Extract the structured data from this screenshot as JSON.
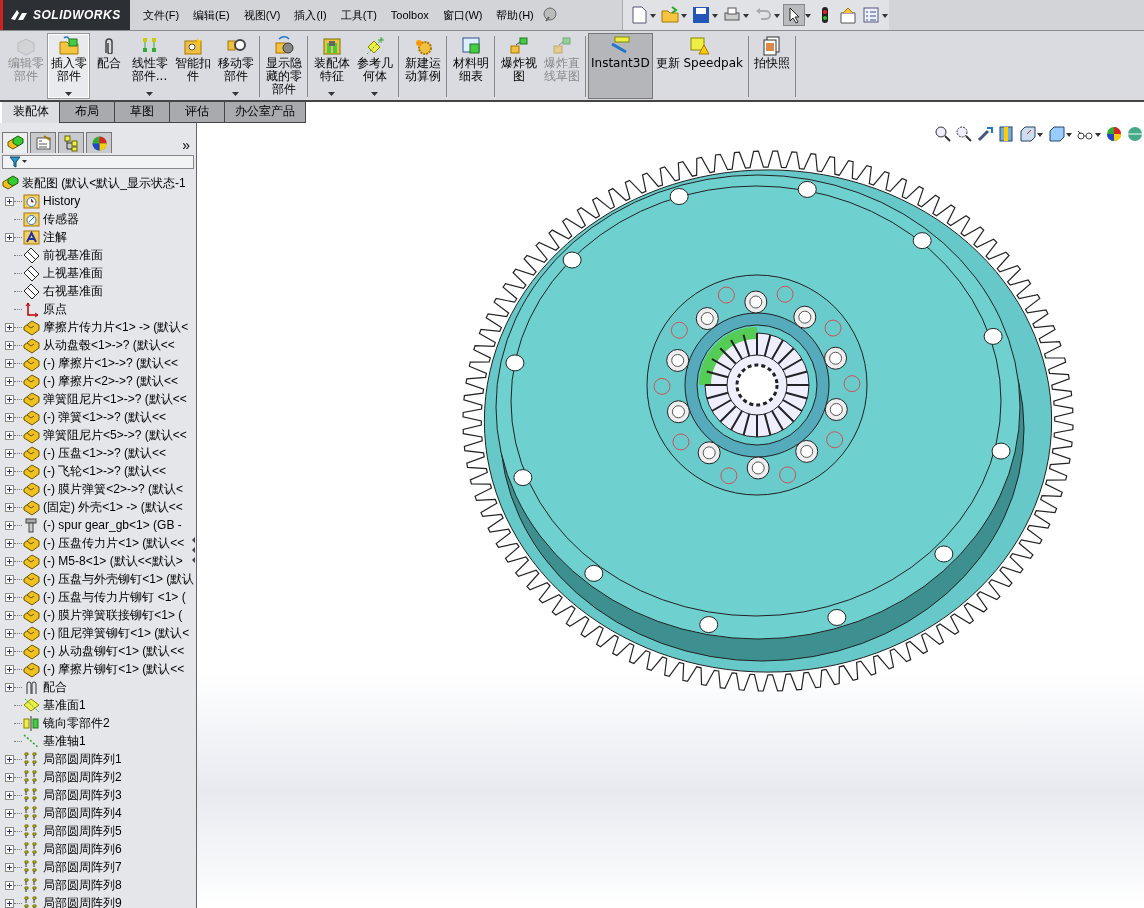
{
  "app": {
    "logo": "SOLIDWORKS"
  },
  "menu": [
    "文件(F)",
    "编辑(E)",
    "视图(V)",
    "插入(I)",
    "工具(T)",
    "Toolbox",
    "窗口(W)",
    "帮助(H)"
  ],
  "command_groups": [
    [
      {
        "label": "编辑零部件",
        "kind": "edit",
        "disabled": true,
        "selected": false,
        "dropdown": false
      },
      {
        "label": "插入零部件",
        "kind": "insert",
        "disabled": false,
        "selected": true,
        "dropdown": true
      },
      {
        "label": "配合",
        "kind": "mate",
        "disabled": false,
        "selected": false,
        "dropdown": false
      },
      {
        "label": "线性零部件...",
        "kind": "pattern",
        "disabled": false,
        "selected": false,
        "dropdown": true
      },
      {
        "label": "智能扣件",
        "kind": "fastener",
        "disabled": false,
        "selected": false,
        "dropdown": false
      },
      {
        "label": "移动零部件",
        "kind": "move",
        "disabled": false,
        "selected": false,
        "dropdown": true
      }
    ],
    [
      {
        "label": "显示隐藏的零部件",
        "kind": "show",
        "disabled": false,
        "selected": false,
        "dropdown": false
      }
    ],
    [
      {
        "label": "装配体特征",
        "kind": "feature",
        "disabled": false,
        "selected": false,
        "dropdown": true
      },
      {
        "label": "参考几何体",
        "kind": "reference",
        "disabled": false,
        "selected": false,
        "dropdown": true
      }
    ],
    [
      {
        "label": "新建运动算例",
        "kind": "motion",
        "disabled": false,
        "selected": false,
        "dropdown": false
      }
    ],
    [
      {
        "label": "材料明细表",
        "kind": "bom",
        "disabled": false,
        "selected": false,
        "dropdown": false
      }
    ],
    [
      {
        "label": "爆炸视图",
        "kind": "explode",
        "disabled": false,
        "selected": false,
        "dropdown": false
      },
      {
        "label": "爆炸直线草图",
        "kind": "explode",
        "disabled": true,
        "selected": false,
        "dropdown": false
      }
    ],
    [
      {
        "label": "Instant3D",
        "kind": "instant3d",
        "disabled": false,
        "selected": true,
        "dropdown": false
      },
      {
        "label": "更新 Speedpak",
        "kind": "speedpak",
        "disabled": false,
        "selected": false,
        "dropdown": false
      }
    ],
    [
      {
        "label": "拍快照",
        "kind": "snapshot",
        "disabled": false,
        "selected": false,
        "dropdown": false
      }
    ]
  ],
  "tabs": [
    {
      "label": "装配体",
      "selected": true
    },
    {
      "label": "布局",
      "selected": false
    },
    {
      "label": "草图",
      "selected": false
    },
    {
      "label": "评估",
      "selected": false
    },
    {
      "label": "办公室产品",
      "selected": false
    }
  ],
  "panel": {
    "tabs": [
      {
        "kind": "features",
        "selected": true
      },
      {
        "kind": "properties",
        "selected": false
      },
      {
        "kind": "configurations",
        "selected": false
      },
      {
        "kind": "display",
        "selected": false
      }
    ],
    "more": "»"
  },
  "tree": {
    "label": "装配图  (默认<默认_显示状态-1",
    "kind": "assembly",
    "children": [
      {
        "label": "History",
        "kind": "history",
        "expandable": true
      },
      {
        "label": "传感器",
        "kind": "sensor",
        "expandable": false
      },
      {
        "label": "注解",
        "kind": "annotation",
        "expandable": true
      },
      {
        "label": "前视基准面",
        "kind": "plane",
        "expandable": false
      },
      {
        "label": "上视基准面",
        "kind": "plane",
        "expandable": false
      },
      {
        "label": "右视基准面",
        "kind": "plane",
        "expandable": false
      },
      {
        "label": "原点",
        "kind": "origin",
        "expandable": false
      },
      {
        "label": "摩擦片传力片<1> -> (默认<",
        "kind": "part",
        "expandable": true
      },
      {
        "label": "从动盘毂<1>->? (默认<<",
        "kind": "part",
        "expandable": true
      },
      {
        "label": "(-) 摩擦片<1>->? (默认<<",
        "kind": "part",
        "expandable": true
      },
      {
        "label": "(-) 摩擦片<2>->? (默认<<",
        "kind": "part",
        "expandable": true
      },
      {
        "label": "弹簧阻尼片<1>->? (默认<<",
        "kind": "part",
        "expandable": true
      },
      {
        "label": "(-) 弹簧<1>->? (默认<<",
        "kind": "part",
        "expandable": true
      },
      {
        "label": "弹簧阻尼片<5>->? (默认<<",
        "kind": "part",
        "expandable": true
      },
      {
        "label": "(-) 压盘<1>->? (默认<<",
        "kind": "part",
        "expandable": true
      },
      {
        "label": "(-) 飞轮<1>->? (默认<<",
        "kind": "part",
        "expandable": true
      },
      {
        "label": "(-) 膜片弹簧<2>->? (默认<",
        "kind": "part",
        "expandable": true
      },
      {
        "label": "(固定) 外壳<1> -> (默认<<",
        "kind": "part",
        "expandable": true
      },
      {
        "label": "(-) spur gear_gb<1> (GB -",
        "kind": "bolt",
        "expandable": true
      },
      {
        "label": "(-) 压盘传力片<1> (默认<<",
        "kind": "part",
        "expandable": true
      },
      {
        "label": "(-) M5-8<1> (默认<<默认>",
        "kind": "part",
        "expandable": true
      },
      {
        "label": "(-) 压盘与外壳铆钉<1> (默认",
        "kind": "part",
        "expandable": true
      },
      {
        "label": "(-) 压盘与传力片铆钉 <1> (",
        "kind": "part",
        "expandable": true
      },
      {
        "label": "(-) 膜片弹簧联接铆钉<1> (",
        "kind": "part",
        "expandable": true
      },
      {
        "label": "(-) 阻尼弹簧铆钉<1> (默认<",
        "kind": "part",
        "expandable": true
      },
      {
        "label": "(-) 从动盘铆钉<1> (默认<<",
        "kind": "part",
        "expandable": true
      },
      {
        "label": "(-) 摩擦片铆钉<1> (默认<<",
        "kind": "part",
        "expandable": true
      },
      {
        "label": "配合",
        "kind": "mates",
        "expandable": true
      },
      {
        "label": "基准面1",
        "kind": "refplane",
        "expandable": false
      },
      {
        "label": "镜向零部件2",
        "kind": "mirror",
        "expandable": false
      },
      {
        "label": "基准轴1",
        "kind": "axis",
        "expandable": false
      },
      {
        "label": "局部圆周阵列1",
        "kind": "circpattern",
        "expandable": true
      },
      {
        "label": "局部圆周阵列2",
        "kind": "circpattern",
        "expandable": true
      },
      {
        "label": "局部圆周阵列3",
        "kind": "circpattern",
        "expandable": true
      },
      {
        "label": "局部圆周阵列4",
        "kind": "circpattern",
        "expandable": true
      },
      {
        "label": "局部圆周阵列5",
        "kind": "circpattern",
        "expandable": true
      },
      {
        "label": "局部圆周阵列6",
        "kind": "circpattern",
        "expandable": true
      },
      {
        "label": "局部圆周阵列7",
        "kind": "circpattern",
        "expandable": true
      },
      {
        "label": "局部圆周阵列8",
        "kind": "circpattern",
        "expandable": true
      },
      {
        "label": "局部圆周阵列9",
        "kind": "circpattern",
        "expandable": true
      }
    ]
  }
}
